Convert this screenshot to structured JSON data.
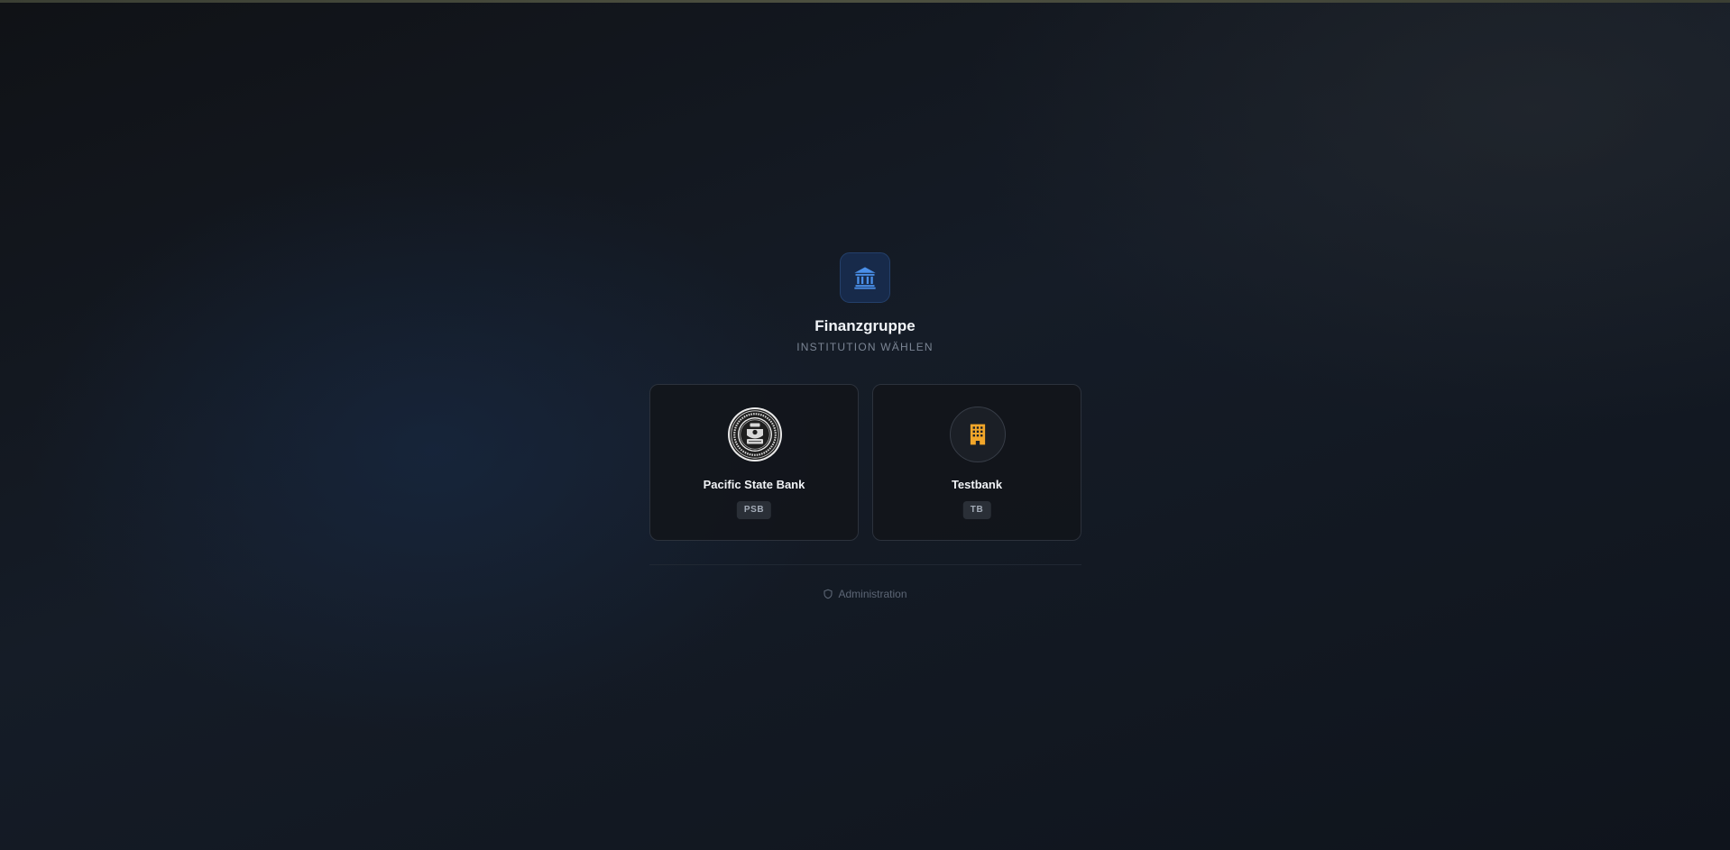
{
  "header": {
    "title": "Finanzgruppe",
    "subtitle": "INSTITUTION WÄHLEN",
    "logo_icon": "bank-icon",
    "accent_color": "#4a8fe8"
  },
  "institutions": [
    {
      "name": "Pacific State Bank",
      "code": "PSB",
      "icon": "pacific-state-bank-seal",
      "seal_text": "PACIFIC STATE BANK · FDIC DEPOSITS"
    },
    {
      "name": "Testbank",
      "code": "TB",
      "icon": "building-icon",
      "icon_color": "#f2a62a"
    }
  ],
  "footer": {
    "admin_label": "Administration",
    "admin_icon": "shield-icon"
  }
}
